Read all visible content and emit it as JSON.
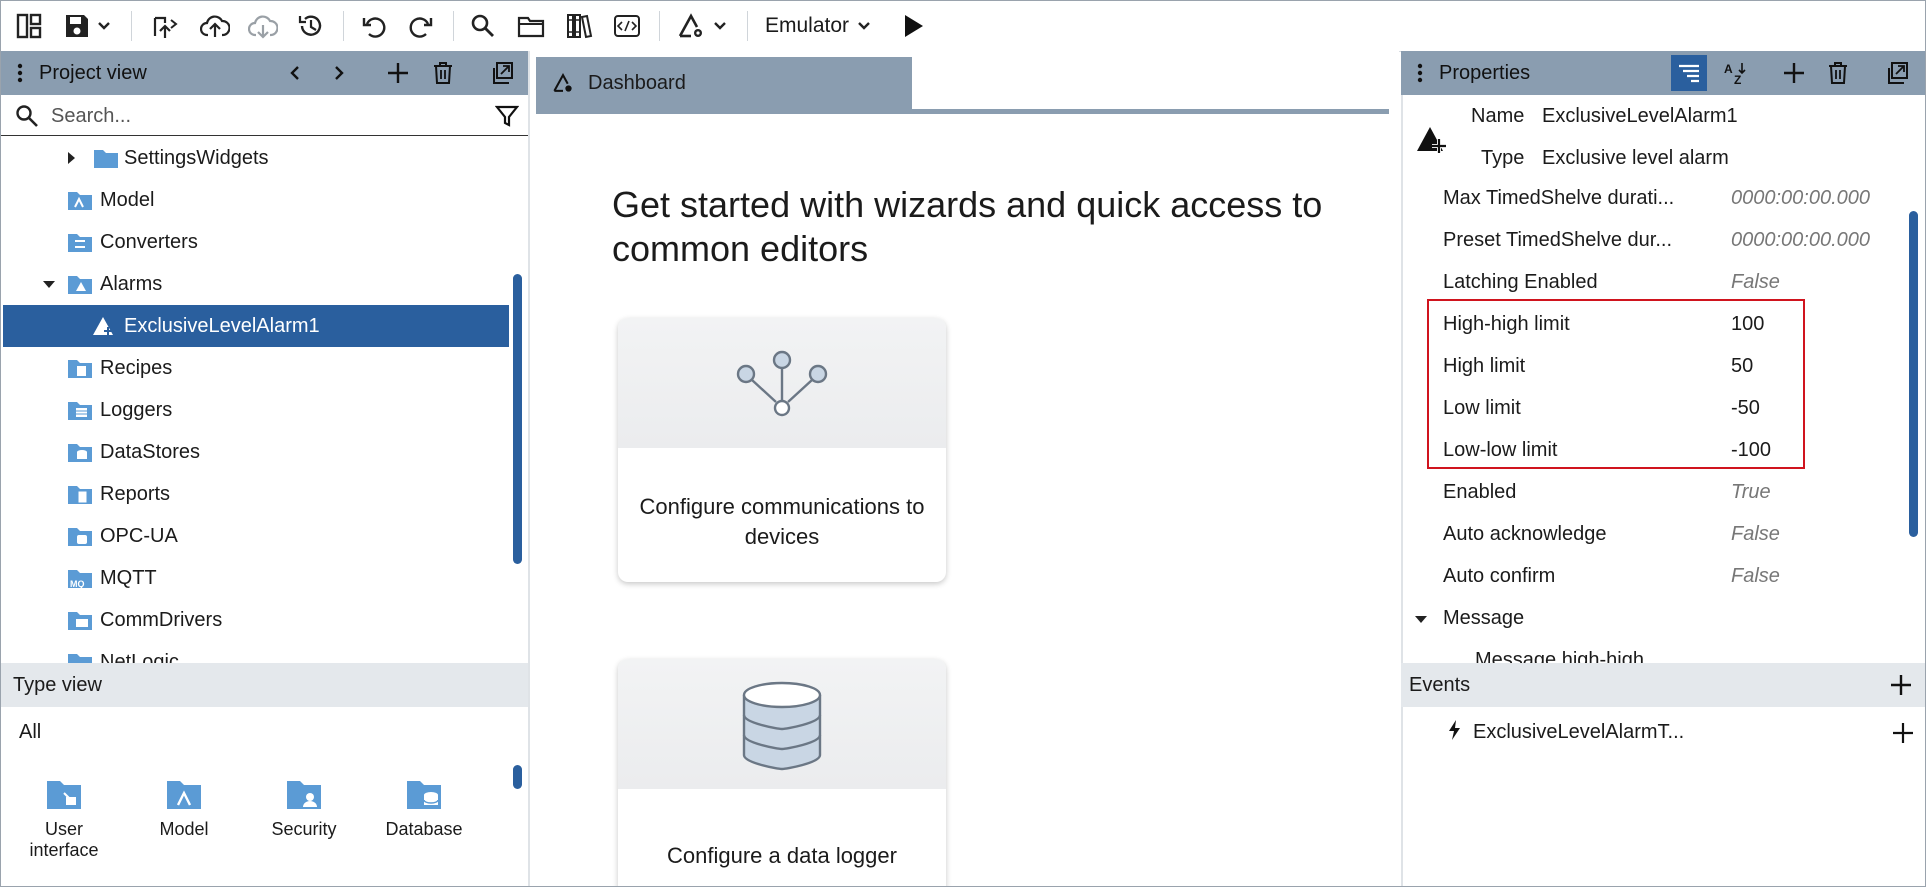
{
  "toolbar": {
    "emulator_label": "Emulator",
    "icons": [
      "layout-icon",
      "save-icon",
      "chevron-down-icon",
      "deploy-icon",
      "upload-icon",
      "download-icon",
      "history-icon",
      "undo-icon",
      "redo-icon",
      "search-icon",
      "folder-icon",
      "library-icon",
      "code-icon",
      "alarm-settings-icon",
      "chevron-down-icon",
      "play-icon"
    ]
  },
  "project_view": {
    "title": "Project view",
    "search_placeholder": "Search...",
    "tree": [
      {
        "label": "SettingsWidgets",
        "icon": "folder-icon",
        "expanded": false
      },
      {
        "label": "Model",
        "icon": "model-folder-icon"
      },
      {
        "label": "Converters",
        "icon": "converters-folder-icon"
      },
      {
        "label": "Alarms",
        "icon": "alarms-folder-icon",
        "expanded": true
      },
      {
        "label": "ExclusiveLevelAlarm1",
        "icon": "alarm-icon",
        "selected": true
      },
      {
        "label": "Recipes",
        "icon": "recipes-folder-icon"
      },
      {
        "label": "Loggers",
        "icon": "loggers-folder-icon"
      },
      {
        "label": "DataStores",
        "icon": "datastores-folder-icon"
      },
      {
        "label": "Reports",
        "icon": "reports-folder-icon"
      },
      {
        "label": "OPC-UA",
        "icon": "opcua-folder-icon"
      },
      {
        "label": "MQTT",
        "icon": "mqtt-folder-icon"
      },
      {
        "label": "CommDrivers",
        "icon": "commdrivers-folder-icon"
      },
      {
        "label": "NetLogic",
        "icon": "netlogic-folder-icon"
      }
    ]
  },
  "type_view": {
    "title": "Type view",
    "filter": "All",
    "items": [
      {
        "label_line1": "User",
        "label_line2": "interface"
      },
      {
        "label_line1": "Model",
        "label_line2": ""
      },
      {
        "label_line1": "Security",
        "label_line2": ""
      },
      {
        "label_line1": "Database",
        "label_line2": ""
      }
    ]
  },
  "dashboard": {
    "tab_label": "Dashboard",
    "heading": "Get started with wizards and quick access to common editors",
    "cards": [
      {
        "label": "Configure communications to devices",
        "icon": "network-icon"
      },
      {
        "label": "Configure a data logger",
        "icon": "database-icon"
      }
    ]
  },
  "properties": {
    "title": "Properties",
    "name_label": "Name",
    "name_value": "ExclusiveLevelAlarm1",
    "type_label": "Type",
    "type_value": "Exclusive level alarm",
    "rows": [
      {
        "key": "Max TimedShelve durati...",
        "value": "0000:00:00.000",
        "default": true
      },
      {
        "key": "Preset TimedShelve dur...",
        "value": "0000:00:00.000",
        "default": true
      },
      {
        "key": "Latching Enabled",
        "value": "False",
        "default": true
      },
      {
        "key": "High-high limit",
        "value": "100",
        "default": false
      },
      {
        "key": "High limit",
        "value": "50",
        "default": false
      },
      {
        "key": "Low limit",
        "value": "-50",
        "default": false
      },
      {
        "key": "Low-low limit",
        "value": "-100",
        "default": false
      },
      {
        "key": "Enabled",
        "value": "True",
        "default": true
      },
      {
        "key": "Auto acknowledge",
        "value": "False",
        "default": true
      },
      {
        "key": "Auto confirm",
        "value": "False",
        "default": true
      }
    ],
    "message_group": "Message",
    "message_child": "Message high-high"
  },
  "events": {
    "title": "Events",
    "items": [
      {
        "label": "ExclusiveLevelAlarmT..."
      }
    ]
  },
  "colors": {
    "header": "#8a9db0",
    "selected": "#2a5f9e",
    "folder": "#5b9bd5",
    "highlight_box": "#d0141e"
  }
}
